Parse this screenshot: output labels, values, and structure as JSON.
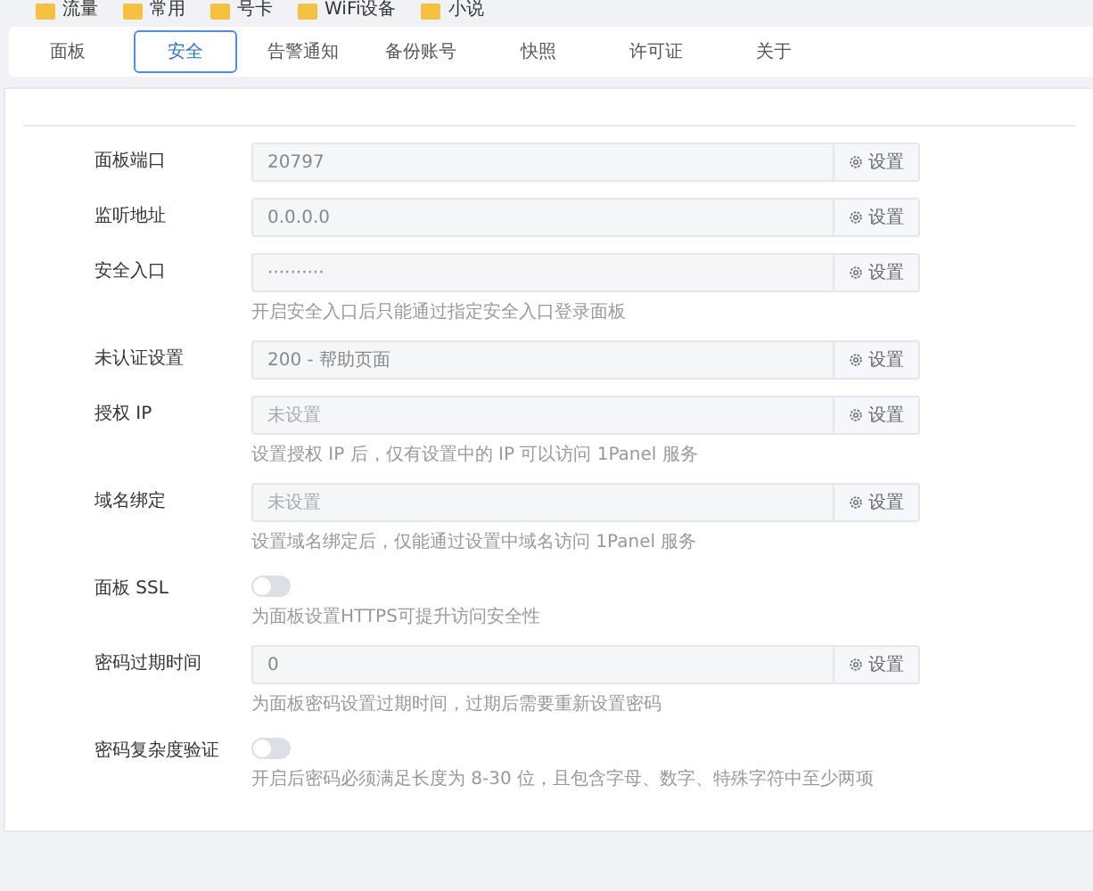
{
  "bookmarks": [
    {
      "label": "流量"
    },
    {
      "label": "常用"
    },
    {
      "label": "号卡"
    },
    {
      "label": "WiFi设备"
    },
    {
      "label": "小说"
    }
  ],
  "tabs": [
    {
      "label": "面板",
      "selected": false
    },
    {
      "label": "安全",
      "selected": true
    },
    {
      "label": "告警通知",
      "selected": false
    },
    {
      "label": "备份账号",
      "selected": false
    },
    {
      "label": "快照",
      "selected": false
    },
    {
      "label": "许可证",
      "selected": false
    },
    {
      "label": "关于",
      "selected": false
    }
  ],
  "settings": [
    {
      "kind": "input",
      "label": "面板端口",
      "value": "20797",
      "button": "设置"
    },
    {
      "kind": "input",
      "label": "监听地址",
      "value": "0.0.0.0",
      "button": "设置"
    },
    {
      "kind": "input",
      "label": "安全入口",
      "value": "··········",
      "button": "设置",
      "help": "开启安全入口后只能通过指定安全入口登录面板"
    },
    {
      "kind": "input",
      "label": "未认证设置",
      "value": "200 - 帮助页面",
      "button": "设置"
    },
    {
      "kind": "input",
      "label": "授权 IP",
      "placeholder": "未设置",
      "button": "设置",
      "help": "设置授权 IP 后，仅有设置中的 IP 可以访问 1Panel 服务"
    },
    {
      "kind": "input",
      "label": "域名绑定",
      "placeholder": "未设置",
      "button": "设置",
      "help": "设置域名绑定后，仅能通过设置中域名访问 1Panel 服务"
    },
    {
      "kind": "switch",
      "label": "面板 SSL",
      "on": false,
      "help": "为面板设置HTTPS可提升访问安全性"
    },
    {
      "kind": "input",
      "label": "密码过期时间",
      "value": "0",
      "button": "设置",
      "help": "为面板密码设置过期时间，过期后需要重新设置密码"
    },
    {
      "kind": "switch",
      "label": "密码复杂度验证",
      "on": false,
      "help": "开启后密码必须满足长度为 8-30 位，且包含字母、数字、特殊字符中至少两项"
    }
  ]
}
